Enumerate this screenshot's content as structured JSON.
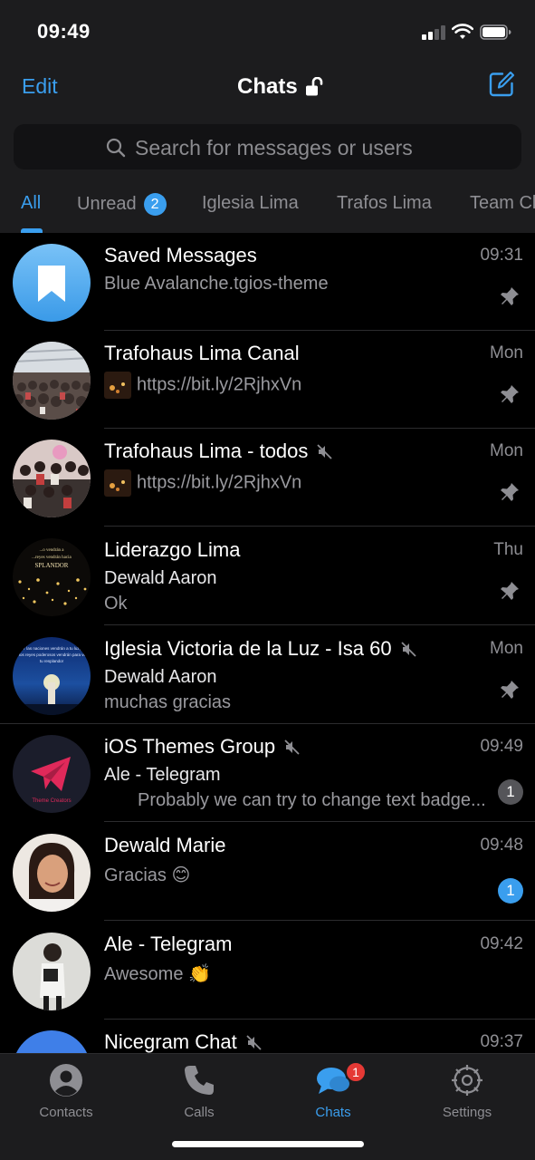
{
  "status_bar": {
    "time": "09:49"
  },
  "nav": {
    "edit_label": "Edit",
    "title": "Chats"
  },
  "search": {
    "placeholder": "Search for messages or users"
  },
  "filters": [
    {
      "label": "All",
      "active": true
    },
    {
      "label": "Unread",
      "badge": "2"
    },
    {
      "label": "Iglesia Lima"
    },
    {
      "label": "Trafos Lima"
    },
    {
      "label": "Team Cl"
    }
  ],
  "chats": [
    {
      "title": "Saved Messages",
      "time": "09:31",
      "line1": "Blue Avalanche.tgios-theme",
      "pinned": true
    },
    {
      "title": "Trafohaus Lima Canal",
      "time": "Mon",
      "line1": "https://bit.ly/2RjhxVn",
      "pinned": true
    },
    {
      "title": "Trafohaus Lima - todos",
      "time": "Mon",
      "line1": "https://bit.ly/2RjhxVn",
      "muted": true,
      "pinned": true
    },
    {
      "title": "Liderazgo Lima",
      "time": "Thu",
      "sender": "Dewald Aaron",
      "line2": "Ok",
      "pinned": true
    },
    {
      "title": "Iglesia Victoria de la Luz - Isa 60",
      "time": "Mon",
      "sender": "Dewald Aaron",
      "line2": "muchas gracias",
      "muted": true,
      "pinned": true
    },
    {
      "title": "iOS Themes Group",
      "time": "09:49",
      "sender": "Ale - Telegram",
      "line2": "Probably we can try to change text badge...",
      "muted": true,
      "badge": "1"
    },
    {
      "title": "Dewald Marie",
      "time": "09:48",
      "line1": "Gracias 😊",
      "badge": "1"
    },
    {
      "title": "Ale - Telegram",
      "time": "09:42",
      "line1": "Awesome 👏"
    },
    {
      "title": "Nicegram Chat",
      "time": "09:37",
      "muted": true
    }
  ],
  "avatar_texts": {
    "liderazgo": [
      "...o vendrán a",
      "...reyes vendrán hacia",
      "SPLANDOR"
    ],
    "iglesia": [
      "Y las naciones vendrán a tu luz,",
      "y los reyes poderosos vendrán para ver",
      "tu resplandor"
    ],
    "ios_themes": "Theme Creators"
  },
  "tabs": [
    {
      "label": "Contacts"
    },
    {
      "label": "Calls"
    },
    {
      "label": "Chats",
      "active": true,
      "badge": "1"
    },
    {
      "label": "Settings"
    }
  ],
  "colors": {
    "accent": "#3a9eee",
    "background": "#000000",
    "bar": "#1c1c1e",
    "muted_badge": "#555559",
    "tab_badge": "#e53935"
  }
}
